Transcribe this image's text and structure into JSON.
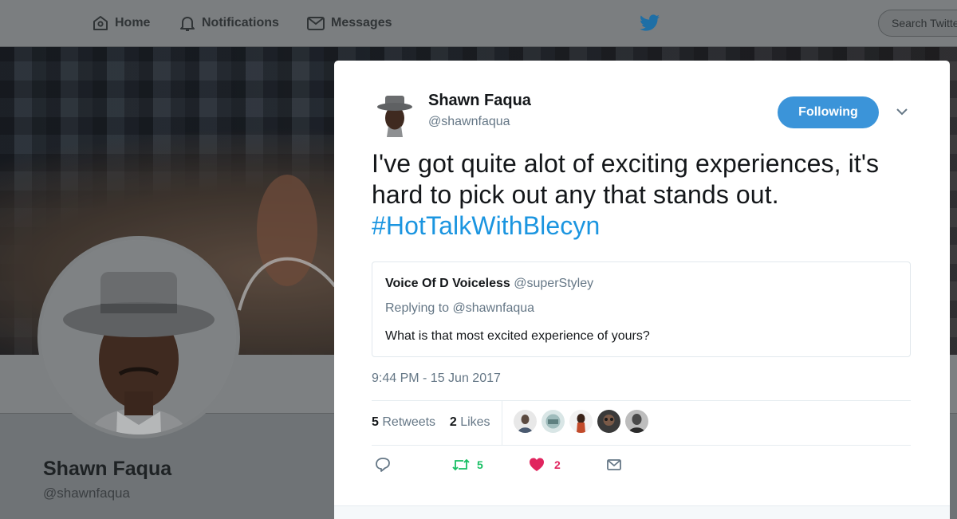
{
  "nav": {
    "home_label": "Home",
    "notifications_label": "Notifications",
    "messages_label": "Messages",
    "search_placeholder": "Search Twitter"
  },
  "profile": {
    "name": "Shawn Faqua",
    "handle": "@shawnfaqua"
  },
  "tweet": {
    "author_name": "Shawn Faqua",
    "author_handle": "@shawnfaqua",
    "follow_label": "Following",
    "text_line": "I've got quite alot of exciting experiences, it's hard to pick out any that stands out.",
    "hashtag": "#HotTalkWithBlecyn",
    "quote": {
      "name": "Voice Of D Voiceless",
      "handle": "@superStyley",
      "replying_prefix": "Replying to",
      "replying_to": "@shawnfaqua",
      "text": "What is that most excited experience of yours?"
    },
    "timestamp": "9:44 PM - 15 Jun 2017",
    "retweets_count": "5",
    "retweets_label": "Retweets",
    "likes_count": "2",
    "likes_label": "Likes",
    "action_retweet_count": "5",
    "action_like_count": "2"
  },
  "colors": {
    "accent": "#1b95e0",
    "follow_button": "#3b94d9",
    "retweet": "#17bf63",
    "like": "#e0245e"
  },
  "icons": [
    "home-icon",
    "bell-icon",
    "envelope-icon",
    "twitter-bird-icon",
    "chevron-down-icon",
    "reply-icon",
    "retweet-icon",
    "heart-icon",
    "direct-message-icon"
  ]
}
